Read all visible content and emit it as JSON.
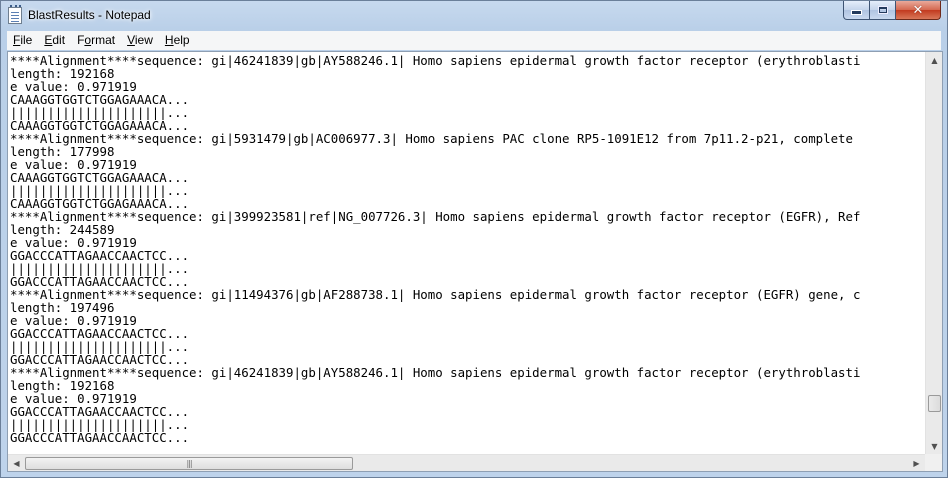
{
  "window": {
    "title": "BlastResults - Notepad",
    "icon": "notepad-icon"
  },
  "caption": {
    "minimize_icon": "minimize-icon",
    "maximize_icon": "maximize-icon",
    "close_icon": "close-icon",
    "close_glyph": "✕"
  },
  "menu": {
    "items": [
      {
        "label": "File",
        "mnemonic": "F",
        "rest": "ile"
      },
      {
        "label": "Edit",
        "mnemonic": "E",
        "rest": "dit"
      },
      {
        "label": "Format",
        "prefix": "F",
        "mnemonic": "o",
        "rest": "rmat"
      },
      {
        "label": "View",
        "mnemonic": "V",
        "rest": "iew"
      },
      {
        "label": "Help",
        "mnemonic": "H",
        "rest": "elp"
      }
    ]
  },
  "document": {
    "lines": [
      "****Alignment****sequence: gi|46241839|gb|AY588246.1| Homo sapiens epidermal growth factor receptor (erythroblasti",
      "length: 192168",
      "e value: 0.971919",
      "CAAAGGTGGTCTGGAGAAACA...",
      "|||||||||||||||||||||...",
      "CAAAGGTGGTCTGGAGAAACA...",
      "****Alignment****sequence: gi|5931479|gb|AC006977.3| Homo sapiens PAC clone RP5-1091E12 from 7p11.2-p21, complete",
      "length: 177998",
      "e value: 0.971919",
      "CAAAGGTGGTCTGGAGAAACA...",
      "|||||||||||||||||||||...",
      "CAAAGGTGGTCTGGAGAAACA...",
      "****Alignment****sequence: gi|399923581|ref|NG_007726.3| Homo sapiens epidermal growth factor receptor (EGFR), Ref",
      "length: 244589",
      "e value: 0.971919",
      "GGACCCATTAGAACCAACTCC...",
      "|||||||||||||||||||||...",
      "GGACCCATTAGAACCAACTCC...",
      "****Alignment****sequence: gi|11494376|gb|AF288738.1| Homo sapiens epidermal growth factor receptor (EGFR) gene, c",
      "length: 197496",
      "e value: 0.971919",
      "GGACCCATTAGAACCAACTCC...",
      "|||||||||||||||||||||...",
      "GGACCCATTAGAACCAACTCC...",
      "****Alignment****sequence: gi|46241839|gb|AY588246.1| Homo sapiens epidermal growth factor receptor (erythroblasti",
      "length: 192168",
      "e value: 0.971919",
      "GGACCCATTAGAACCAACTCC...",
      "|||||||||||||||||||||...",
      "GGACCCATTAGAACCAACTCC..."
    ]
  },
  "scrollbars": {
    "up_glyph": "▲",
    "down_glyph": "▼",
    "left_glyph": "◀",
    "right_glyph": "▶",
    "grip_glyph": "|||"
  }
}
